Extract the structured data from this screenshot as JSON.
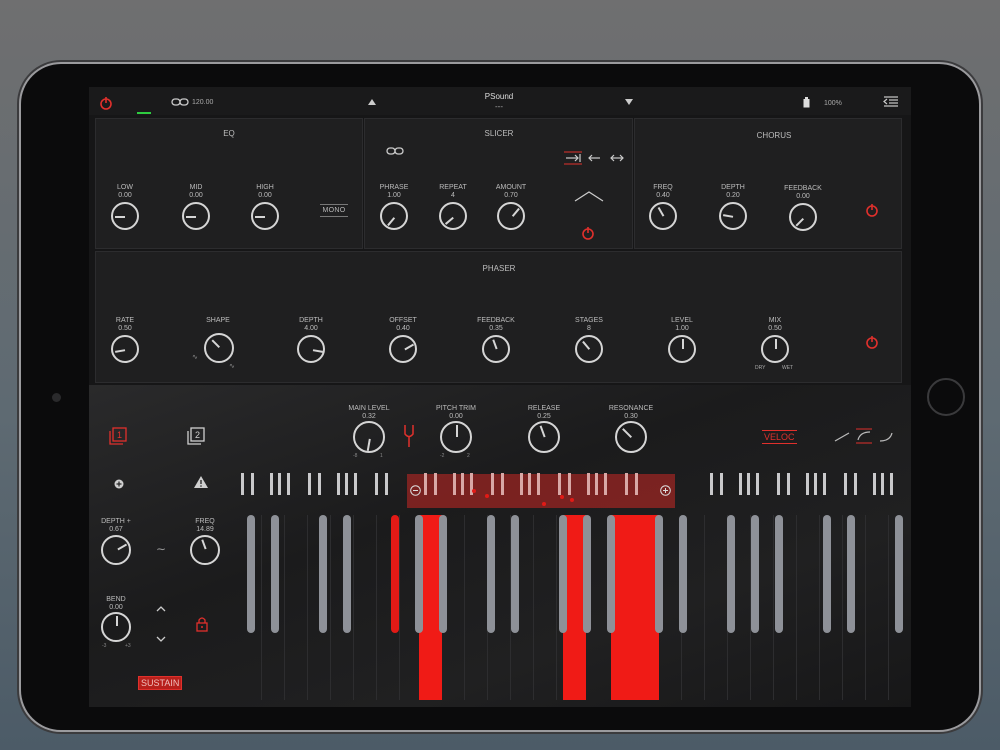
{
  "top_bar": {
    "bpm": "120.00",
    "preset_name": "PSound",
    "preset_sub": "---",
    "battery": "100%"
  },
  "eq": {
    "title": "EQ",
    "knobs": [
      {
        "label": "LOW",
        "value": "0.00"
      },
      {
        "label": "MID",
        "value": "0.00"
      },
      {
        "label": "HIGH",
        "value": "0.00"
      }
    ],
    "mono_label": "MONO"
  },
  "slicer": {
    "title": "SLICER",
    "knobs": [
      {
        "label": "PHRASE",
        "value": "1.00"
      },
      {
        "label": "REPEAT",
        "value": "4"
      },
      {
        "label": "AMOUNT",
        "value": "0.70"
      }
    ]
  },
  "chorus": {
    "title": "CHORUS",
    "knobs": [
      {
        "label": "FREQ",
        "value": "0.40"
      },
      {
        "label": "DEPTH",
        "value": "0.20"
      },
      {
        "label": "FEEDBACK",
        "value": "0.00"
      }
    ]
  },
  "phaser": {
    "title": "PHASER",
    "knobs": [
      {
        "label": "RATE",
        "value": "0.50"
      },
      {
        "label": "SHAPE",
        "value": ""
      },
      {
        "label": "DEPTH",
        "value": "4.00"
      },
      {
        "label": "OFFSET",
        "value": "0.40"
      },
      {
        "label": "FEEDBACK",
        "value": "0.35"
      },
      {
        "label": "STAGES",
        "value": "8"
      },
      {
        "label": "LEVEL",
        "value": "1.00"
      },
      {
        "label": "MIX",
        "value": "0.50"
      }
    ],
    "mix_dry": "DRY",
    "mix_wet": "WET"
  },
  "performance": {
    "knobs": [
      {
        "label": "MAIN LEVEL",
        "value": "0.32"
      },
      {
        "label": "PITCH TRIM",
        "value": "0.00"
      },
      {
        "label": "RELEASE",
        "value": "0.25"
      },
      {
        "label": "RESONANCE",
        "value": "0.30"
      }
    ],
    "main_level_min": "-8",
    "main_level_max": "1",
    "pitch_min": "-2",
    "pitch_max": "2",
    "veloc_label": "VELOC",
    "slot1": "1",
    "slot2": "2"
  },
  "modulation": {
    "depth_label": "DEPTH +",
    "depth_value": "0.67",
    "freq_label": "FREQ",
    "freq_value": "14.89",
    "bend_label": "BEND",
    "bend_value": "0.00",
    "bend_min": "-3",
    "bend_max": "+3",
    "sustain_label": "SUSTAIN"
  },
  "colors": {
    "accent": "#e0302c",
    "panel": "#1f1f20",
    "key_gray": "#8e9198"
  }
}
